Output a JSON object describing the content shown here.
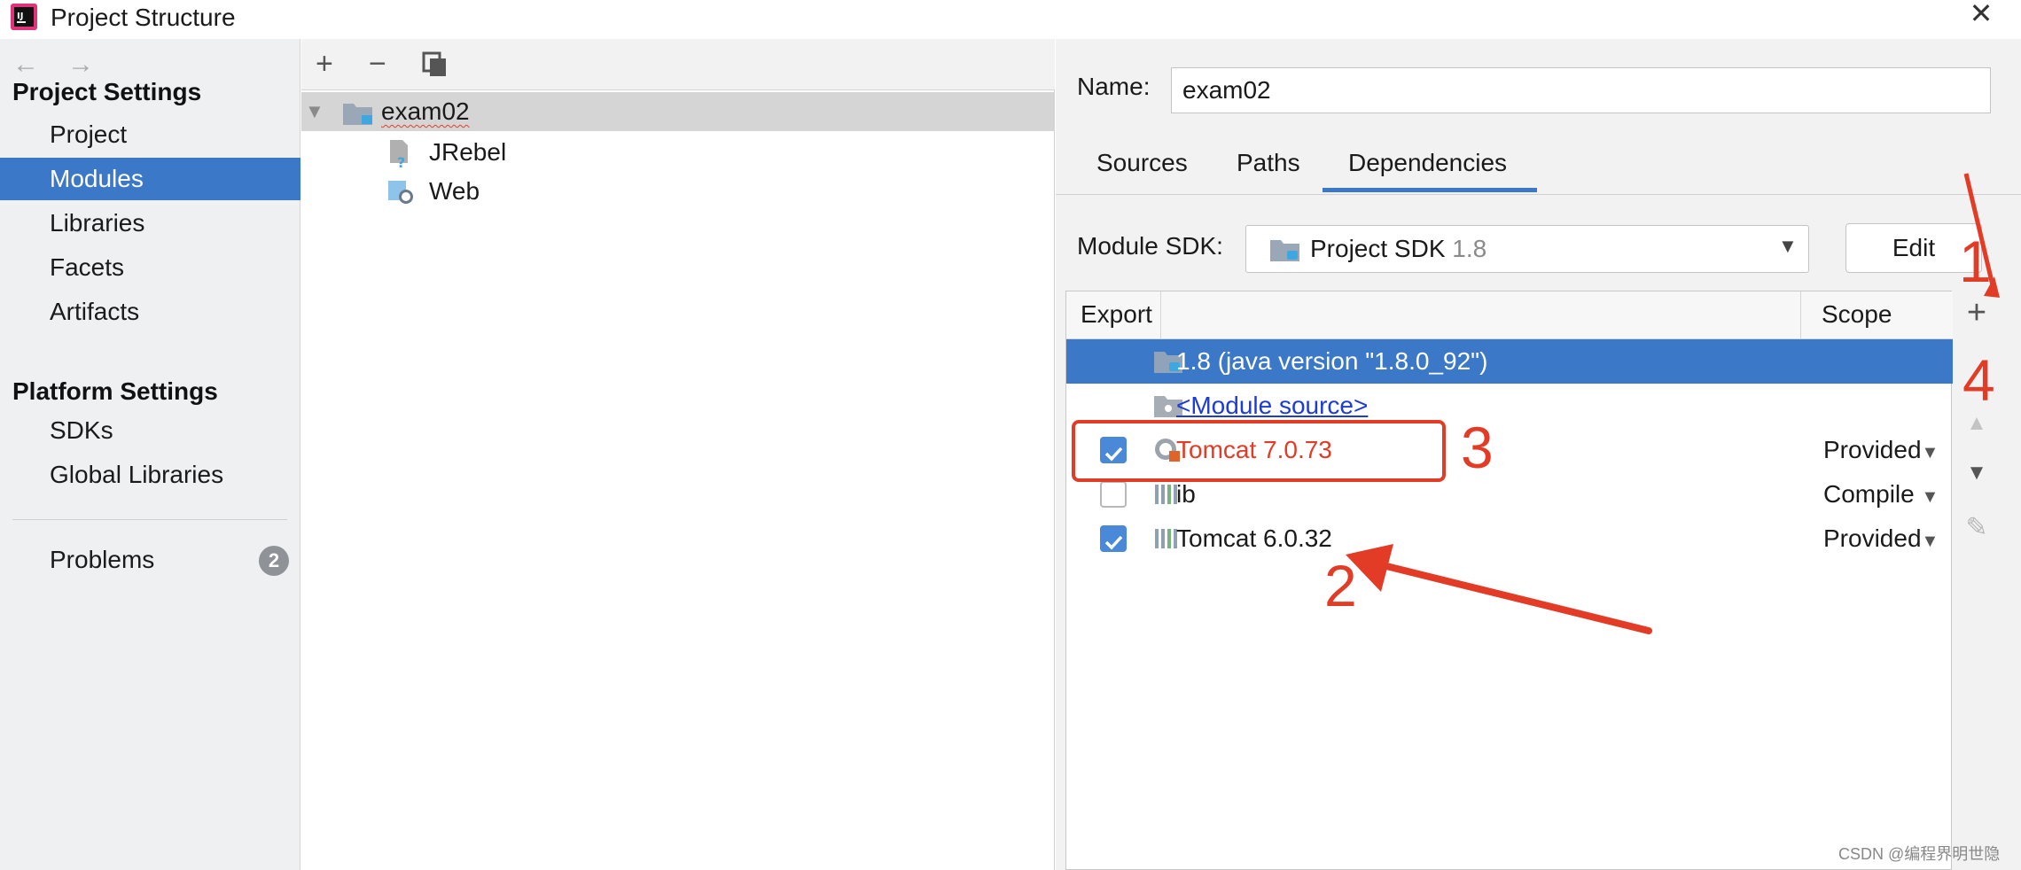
{
  "window": {
    "title": "Project Structure",
    "close_icon": "close-icon"
  },
  "sidebar": {
    "back_icon": "arrow-left-icon",
    "forward_icon": "arrow-right-icon",
    "project_settings_heading": "Project Settings",
    "project_settings_items": [
      "Project",
      "Modules",
      "Libraries",
      "Facets",
      "Artifacts"
    ],
    "platform_settings_heading": "Platform Settings",
    "platform_settings_items": [
      "SDKs",
      "Global Libraries"
    ],
    "problems_label": "Problems",
    "problems_count": "2",
    "selected_item": "Modules"
  },
  "tree": {
    "toolbar": {
      "add_icon": "plus-icon",
      "remove_icon": "minus-icon",
      "copy_icon": "copy-icon"
    },
    "root": "exam02",
    "children": [
      "JRebel",
      "Web"
    ]
  },
  "module": {
    "name_label": "Name:",
    "name_value": "exam02",
    "tabs": [
      "Sources",
      "Paths",
      "Dependencies"
    ],
    "active_tab": "Dependencies",
    "sdk_label": "Module SDK:",
    "sdk_value": "Project SDK",
    "sdk_version": "1.8",
    "edit_label": "Edit"
  },
  "dependencies": {
    "headers": {
      "export": "Export",
      "scope": "Scope"
    },
    "rows": [
      {
        "name": "1.8 (java version \"1.8.0_92\")",
        "scope": "",
        "checked": null,
        "selected": true
      },
      {
        "name": "<Module source>",
        "scope": "",
        "checked": null,
        "selected": false
      },
      {
        "name": "Tomcat 7.0.73",
        "scope": "Provided",
        "checked": true,
        "selected": false
      },
      {
        "name": "ib",
        "scope": "Compile",
        "checked": false,
        "selected": false
      },
      {
        "name": "Tomcat 6.0.32",
        "scope": "Provided",
        "checked": true,
        "selected": false
      }
    ],
    "side_toolbar": [
      "plus-icon",
      "arrow-up-icon",
      "arrow-down-icon",
      "pencil-icon"
    ]
  },
  "annotations": {
    "num1": "1",
    "num2": "2",
    "num3": "3",
    "num4": "4",
    "color": "#e23b26"
  },
  "watermark": "CSDN @编程界明世隐",
  "colors": {
    "selection": "#3c78c8",
    "sidebar_bg": "#eef0f2",
    "panel_bg": "#f2f2f2",
    "link": "#1d3bd6",
    "error_red": "#e23b26"
  }
}
